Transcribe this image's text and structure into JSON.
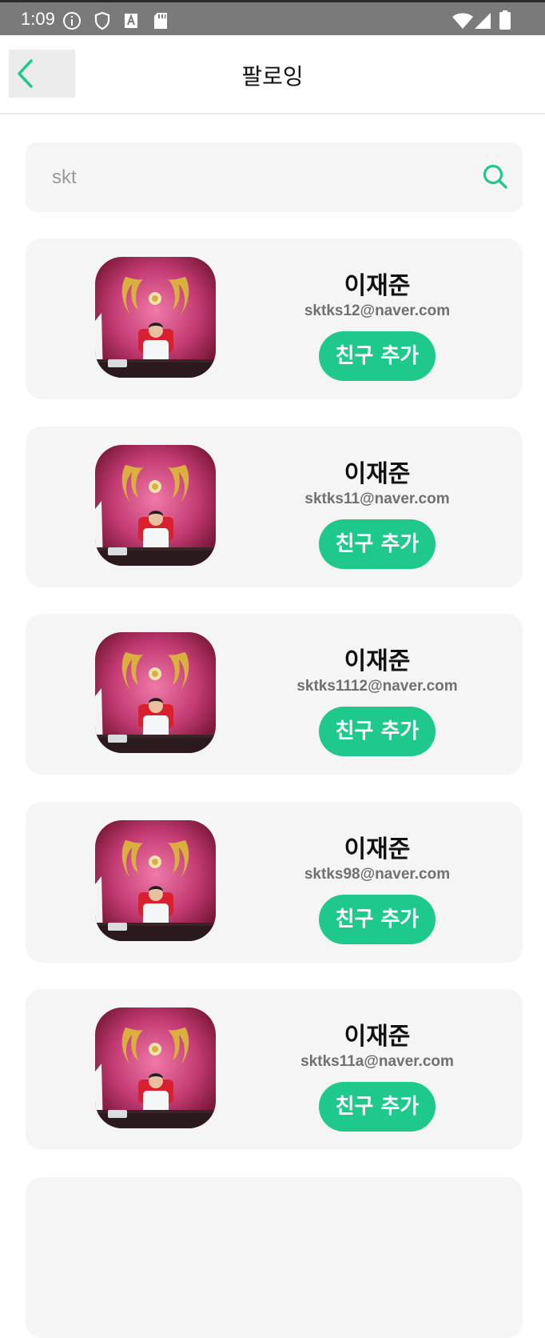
{
  "status_bar": {
    "time": "1:09"
  },
  "header": {
    "title": "팔로잉"
  },
  "search": {
    "value": "skt"
  },
  "colors": {
    "accent": "#1fc98c",
    "card_bg": "#f5f5f5"
  },
  "users": [
    {
      "name": "이재준",
      "email": "sktks12@naver.com",
      "button": "친구 추가"
    },
    {
      "name": "이재준",
      "email": "sktks11@naver.com",
      "button": "친구 추가"
    },
    {
      "name": "이재준",
      "email": "sktks1112@naver.com",
      "button": "친구 추가"
    },
    {
      "name": "이재준",
      "email": "sktks98@naver.com",
      "button": "친구 추가"
    },
    {
      "name": "이재준",
      "email": "sktks11a@naver.com",
      "button": "친구 추가"
    }
  ]
}
